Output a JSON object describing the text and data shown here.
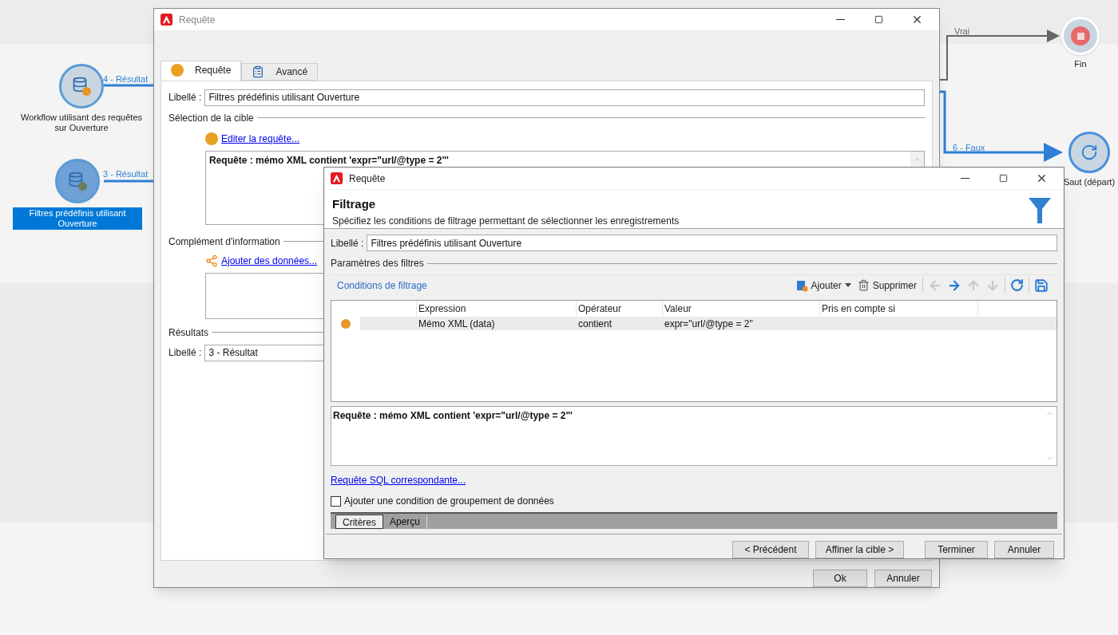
{
  "canvas": {
    "nodes": [
      {
        "kind": "query",
        "label": "Workflow utilisant des requêtes sur Ouverture",
        "selected": false,
        "color": "#e8962a"
      },
      {
        "kind": "query",
        "label": "Filtres prédéfinis utilisant Ouverture",
        "selected": true,
        "color": "#6b7f5a"
      },
      {
        "kind": "end",
        "label": "Fin",
        "selected": false
      },
      {
        "kind": "jump",
        "label": "Saut (départ)",
        "selected": false
      }
    ],
    "transitions": [
      {
        "label": "4 - Résultat",
        "color": "#2f7fd6"
      },
      {
        "label": "3 - Résultat",
        "color": "#2f7fd6"
      },
      {
        "label": "Vrai",
        "color": "#666666"
      },
      {
        "label": "6 - Faux",
        "color": "#2f7fd6"
      }
    ]
  },
  "back_window": {
    "title": "Requête",
    "tabs": [
      {
        "label": "Requête",
        "selected": true
      },
      {
        "label": "Avancé",
        "selected": false
      }
    ],
    "label_field": {
      "label": "Libellé :",
      "value": "Filtres prédéfinis utilisant Ouverture"
    },
    "target_section": "Sélection de la cible",
    "edit_link": "Editer la requête...",
    "query_text": "Requête : mémo XML contient 'expr=\"url/@type = 2\"'",
    "info_section": "Complément d'information",
    "add_data_link": "Ajouter des données...",
    "results_section": "Résultats",
    "results_field": {
      "label": "Libellé :",
      "value": "3 - Résultat"
    },
    "buttons": [
      "Ok",
      "Annuler"
    ]
  },
  "front_window": {
    "title": "Requête",
    "heading": "Filtrage",
    "subheading": "Spécifiez les conditions de filtrage permettant de sélectionner les enregistrements",
    "label_field": {
      "label": "Libellé :",
      "value": "Filtres prédéfinis utilisant Ouverture"
    },
    "params_section": "Paramètres des filtres",
    "toolbar": {
      "title": "Conditions de filtrage",
      "items": [
        {
          "kind": "add",
          "label": "Ajouter",
          "disabled": false
        },
        {
          "kind": "delete",
          "label": "Supprimer",
          "disabled": false
        },
        {
          "kind": "left",
          "disabled": true
        },
        {
          "kind": "right",
          "disabled": false
        },
        {
          "kind": "up",
          "disabled": true
        },
        {
          "kind": "down",
          "disabled": true
        },
        {
          "kind": "refresh",
          "disabled": false
        },
        {
          "kind": "save",
          "disabled": false
        }
      ]
    },
    "table": {
      "columns": [
        "Expression",
        "Opérateur",
        "Valeur",
        "Pris en compte si"
      ],
      "rows": [
        {
          "color": "#e8962a",
          "selected": true,
          "cells": [
            "Mémo XML (data)",
            "contient",
            "expr=\"url/@type = 2\""
          ]
        }
      ]
    },
    "query_text": "Requête : mémo XML contient 'expr=\"url/@type = 2\"'",
    "sql_link": "Requête SQL correspondante...",
    "group_checkbox": {
      "label": "Ajouter une condition de groupement de données",
      "checked": false
    },
    "tabs": [
      {
        "label": "Critères",
        "selected": true
      },
      {
        "label": "Aperçu",
        "selected": false
      }
    ],
    "buttons": [
      "< Précédent",
      "Affiner la cible >",
      "Terminer",
      "Annuler"
    ]
  }
}
